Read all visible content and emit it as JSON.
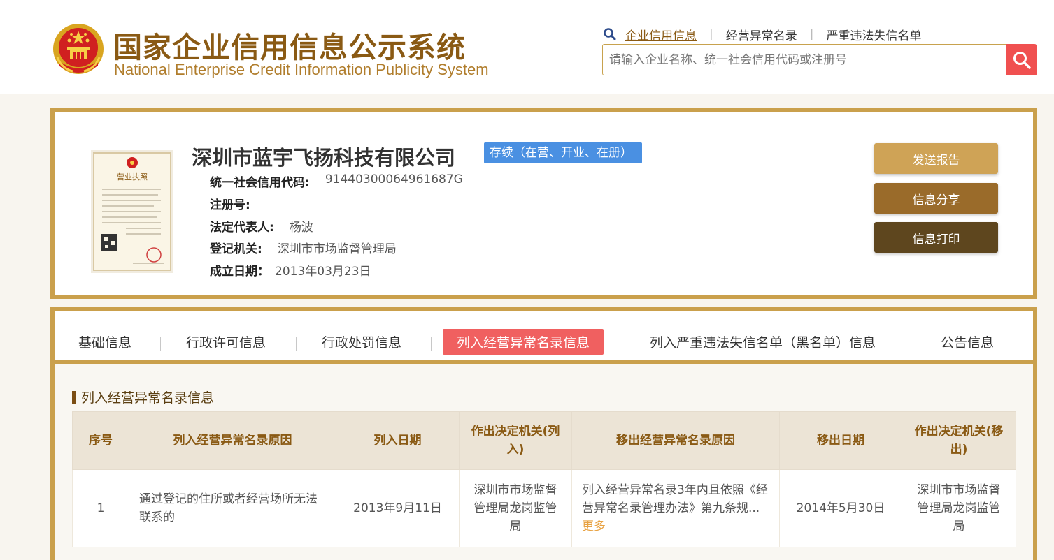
{
  "header": {
    "title_cn": "国家企业信用信息公示系统",
    "title_en": "National Enterprise Credit Information Publicity System",
    "nav": [
      {
        "label": "企业信用信息",
        "active": true
      },
      {
        "label": "经营异常名录",
        "active": false
      },
      {
        "label": "严重违法失信名单",
        "active": false
      }
    ],
    "search_placeholder": "请输入企业名称、统一社会信用代码或注册号"
  },
  "company": {
    "name": "深圳市蓝宇飞扬科技有限公司",
    "status": "存续（在营、开业、在册）",
    "license_title": "营业执照",
    "fields": [
      {
        "key": "统一社会信用代码:",
        "value": "91440300064961687G"
      },
      {
        "key": "注册号:",
        "value": ""
      },
      {
        "key": "法定代表人:",
        "value": "杨波"
      },
      {
        "key": "登记机关:",
        "value": "深圳市市场监督管理局"
      },
      {
        "key": "成立日期：",
        "value": "2013年03月23日"
      }
    ],
    "buttons": {
      "send_report": "发送报告",
      "share": "信息分享",
      "print": "信息打印"
    }
  },
  "tabs": [
    {
      "label": "基础信息",
      "active": false
    },
    {
      "label": "行政许可信息",
      "active": false
    },
    {
      "label": "行政处罚信息",
      "active": false
    },
    {
      "label": "列入经营异常名录信息",
      "active": true
    },
    {
      "label": "列入严重违法失信名单（黑名单）信息",
      "active": false
    },
    {
      "label": "公告信息",
      "active": false
    }
  ],
  "section": {
    "title": "列入经营异常名录信息",
    "columns": [
      "序号",
      "列入经营异常名录原因",
      "列入日期",
      "作出决定机关(列入)",
      "移出经营异常名录原因",
      "移出日期",
      "作出决定机关(移出)"
    ],
    "rows": [
      {
        "index": "1",
        "reason_in": "通过登记的住所或者经营场所无法联系的",
        "date_in": "2013年9月11日",
        "authority_in": "深圳市市场监督管理局龙岗监管局",
        "reason_out": "列入经营异常名录3年内且依照《经营异常名录管理办法》第九条规...",
        "more": "更多",
        "date_out": "2014年5月30日",
        "authority_out": "深圳市市场监督管理局龙岗监管局"
      }
    ]
  },
  "colors": {
    "brand_gold": "#caa04c",
    "title_brown": "#8a5a14",
    "active_tab": "#f06060",
    "status_blue": "#4a90e2",
    "search_red": "#f05050"
  }
}
